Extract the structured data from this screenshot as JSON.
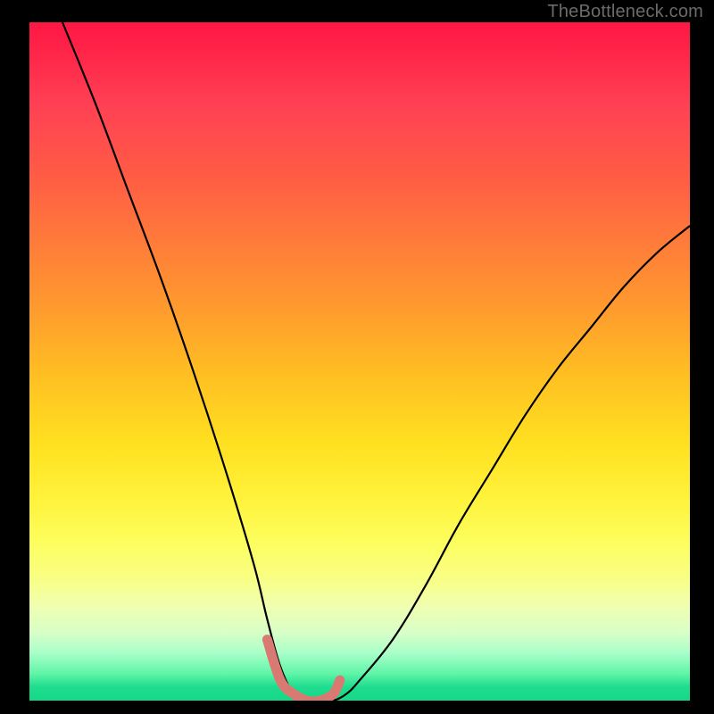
{
  "watermark": "TheBottleneck.com",
  "chart_data": {
    "type": "line",
    "title": "",
    "xlabel": "",
    "ylabel": "",
    "xlim": [
      0,
      100
    ],
    "ylim": [
      0,
      100
    ],
    "grid": false,
    "legend": "none",
    "background": "rainbow-vertical-gradient",
    "notes": "V-shaped bottleneck curve; y≈0 (green) is optimal match, higher y (red) is worse. Minimum at x≈38–47 is highlighted with a thick salmon marker.",
    "series": [
      {
        "name": "bottleneck-curve",
        "color": "#000000",
        "x": [
          5,
          10,
          15,
          20,
          25,
          30,
          34,
          36,
          38,
          40,
          42,
          44,
          46,
          48,
          50,
          55,
          60,
          65,
          70,
          75,
          80,
          85,
          90,
          95,
          100
        ],
        "values": [
          100,
          88,
          75,
          62,
          48,
          33,
          20,
          12,
          5,
          1,
          0,
          0,
          0,
          1,
          3,
          9,
          17,
          26,
          34,
          42,
          49,
          55,
          61,
          66,
          70
        ]
      }
    ],
    "highlight": {
      "name": "optimal-range-marker",
      "color": "#d87a72",
      "x": [
        36,
        38,
        40,
        42,
        44,
        46,
        47
      ],
      "values": [
        9,
        3,
        1,
        0,
        0,
        1,
        3
      ]
    }
  }
}
